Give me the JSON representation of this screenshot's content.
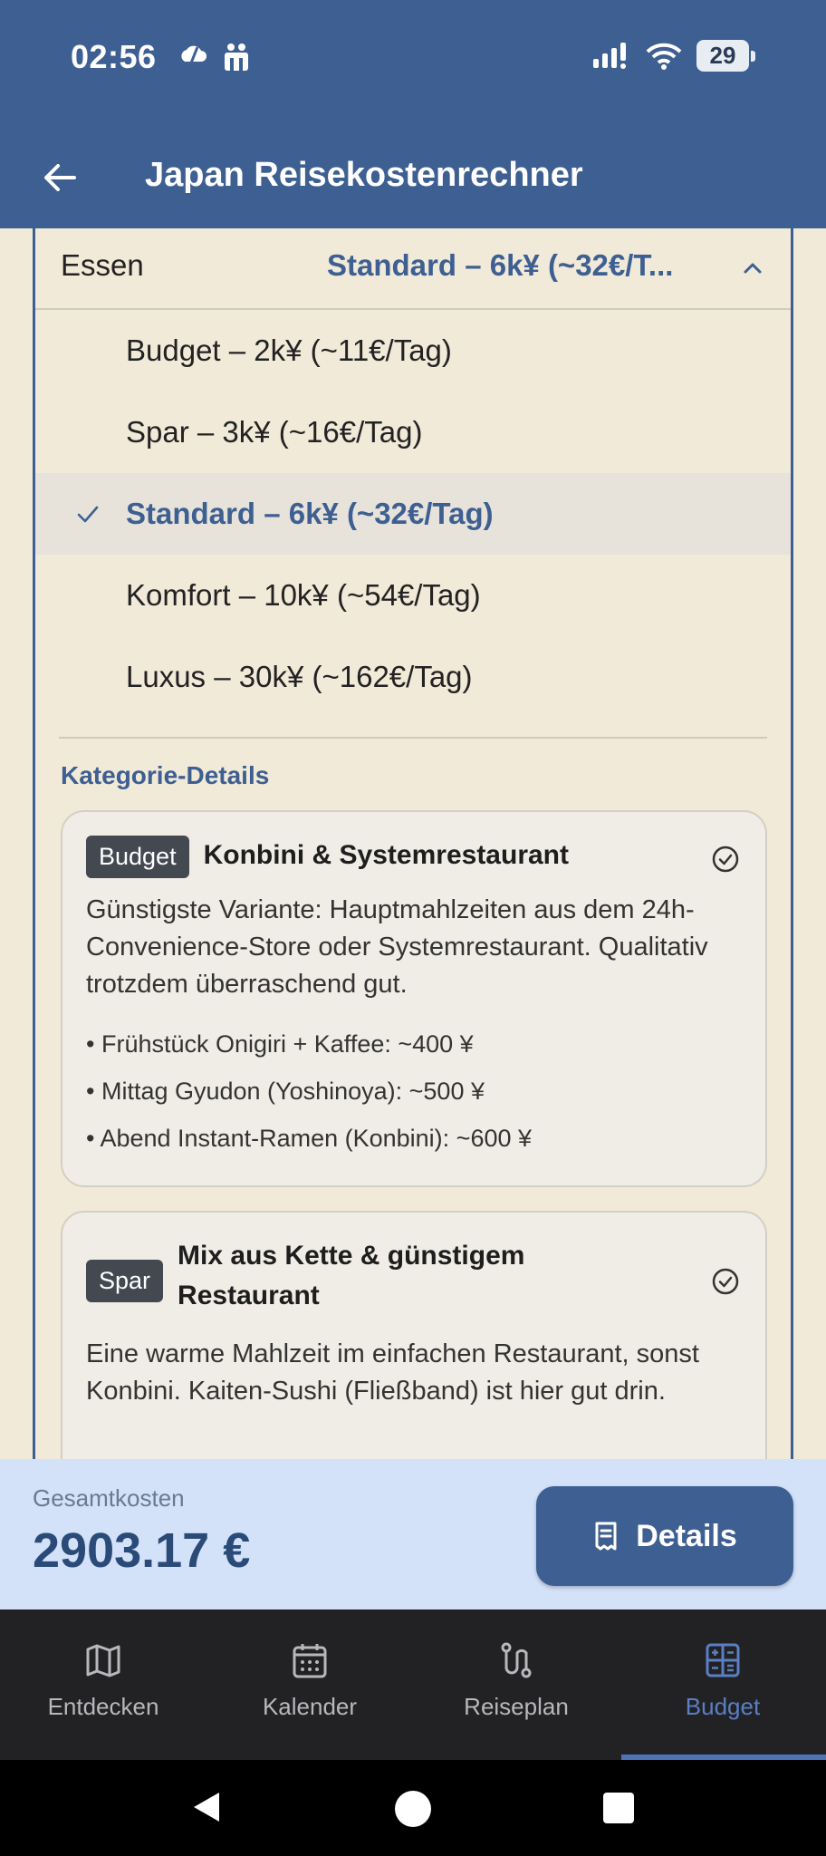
{
  "status_bar": {
    "time": "02:56",
    "battery": "29"
  },
  "app_bar": {
    "title": "Japan Reisekostenrechner"
  },
  "select": {
    "label": "Essen",
    "value": "Standard – 6k¥ (~32€/T..."
  },
  "options": [
    {
      "label": "Budget – 2k¥ (~11€/Tag)",
      "selected": false
    },
    {
      "label": "Spar – 3k¥ (~16€/Tag)",
      "selected": false
    },
    {
      "label": "Standard – 6k¥ (~32€/Tag)",
      "selected": true
    },
    {
      "label": "Komfort – 10k¥ (~54€/Tag)",
      "selected": false
    },
    {
      "label": "Luxus – 30k¥ (~162€/Tag)",
      "selected": false
    }
  ],
  "section_title": "Kategorie-Details",
  "cards": [
    {
      "badge": "Budget",
      "title": "Konbini & Systemrestaurant",
      "description": "Günstigste Variante: Hauptmahlzeiten aus dem 24h-Convenience-Store oder Systemrestaurant. Qualitativ trotzdem überraschend gut.",
      "items": [
        "• Frühstück Onigiri + Kaffee: ~400 ¥",
        "• Mittag Gyudon (Yoshinoya): ~500 ¥",
        "• Abend Instant-Ramen (Konbini): ~600 ¥"
      ]
    },
    {
      "badge": "Spar",
      "title": "Mix aus Kette & günstigem Restaurant",
      "description": "Eine warme Mahlzeit im einfachen Restaurant, sonst Konbini. Kaiten-Sushi (Fließband) ist hier gut drin.",
      "items": []
    }
  ],
  "total": {
    "label": "Gesamtkosten",
    "value": "2903.17 €"
  },
  "details_button": {
    "label": "Details"
  },
  "nav": [
    {
      "label": "Entdecken",
      "icon": "map-icon",
      "active": false
    },
    {
      "label": "Kalender",
      "icon": "calendar-icon",
      "active": false
    },
    {
      "label": "Reiseplan",
      "icon": "route-icon",
      "active": false
    },
    {
      "label": "Budget",
      "icon": "calculator-icon",
      "active": true
    }
  ],
  "colors": {
    "primary": "#3e5f91",
    "background": "#f1ead9",
    "total_bar": "#d3e1f9",
    "nav_bg": "#222225",
    "active_nav": "#5a7fc2"
  }
}
